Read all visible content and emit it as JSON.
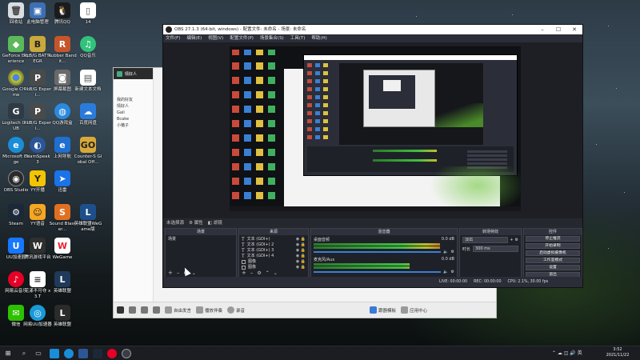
{
  "desktop_icons": [
    {
      "id": "recycle",
      "label": "回收站",
      "icon": "recycle-bin-icon",
      "color": "#d9dde2"
    },
    {
      "id": "geforce",
      "label": "GeForce Experience",
      "icon": "geforce-icon",
      "color": "#5bb85b"
    },
    {
      "id": "chrome",
      "label": "Google Chrome",
      "icon": "chrome-icon",
      "color": "#e53935"
    },
    {
      "id": "logitech",
      "label": "Logitech G HUB",
      "icon": "logitech-icon",
      "color": "#2f3a44"
    },
    {
      "id": "edge",
      "label": "Microsoft Edge",
      "icon": "edge-icon",
      "color": "#1a8dd8"
    },
    {
      "id": "obs",
      "label": "OBS Studio",
      "icon": "obs-icon",
      "color": "#2a2a2a"
    },
    {
      "id": "steam",
      "label": "Steam",
      "icon": "steam-icon",
      "color": "#1b2838"
    },
    {
      "id": "uu",
      "label": "UU加速器",
      "icon": "uu-icon",
      "color": "#1677ff"
    },
    {
      "id": "netease",
      "label": "网易云音乐",
      "icon": "netease-icon",
      "color": "#e60026"
    },
    {
      "id": "wechat",
      "label": "微信",
      "icon": "wechat-icon",
      "color": "#2dc100"
    },
    {
      "id": "computer",
      "label": "此电脑管理",
      "icon": "computer-icon",
      "color": "#3c6fb5"
    },
    {
      "id": "battlerite",
      "label": "RLB/G BATTLEGR",
      "icon": "battleground-icon",
      "color": "#c9a93a"
    },
    {
      "id": "rlbexp1",
      "label": "RLB/G Experi...",
      "icon": "pubg-icon",
      "color": "#4a4a4a"
    },
    {
      "id": "rlbexp2",
      "label": "RLB/G Experi...",
      "icon": "pubg-icon",
      "color": "#4a4a4a"
    },
    {
      "id": "teamspeak",
      "label": "TeamSpeak 3",
      "icon": "teamspeak-icon",
      "color": "#2b5797"
    },
    {
      "id": "yy",
      "label": "YY开播",
      "icon": "yy-icon",
      "color": "#f3c400"
    },
    {
      "id": "yylang",
      "label": "YY语音",
      "icon": "yy-voice-icon",
      "color": "#f5a623"
    },
    {
      "id": "wegame1",
      "label": "腾讯游戏平台",
      "icon": "wegame-icon",
      "color": "#2f2f2f"
    },
    {
      "id": "transmit",
      "label": "花漾不可夺 x3.T",
      "icon": "doc-icon",
      "color": "#ffffff"
    },
    {
      "id": "uninstall",
      "label": "网易UU加速器",
      "icon": "uu-accel-icon",
      "color": "#1a9ad6"
    },
    {
      "id": "qq",
      "label": "腾讯QQ",
      "icon": "qq-icon",
      "color": "#1b1b1b"
    },
    {
      "id": "rubber",
      "label": "Rubber Bandit...",
      "icon": "rubber-icon",
      "color": "#c7552a"
    },
    {
      "id": "shot",
      "label": "屏幕截图",
      "icon": "camera-icon",
      "color": "#6a6a6a"
    },
    {
      "id": "qqgame",
      "label": "QQ游戏盒",
      "icon": "qqgame-icon",
      "color": "#2a8ae0"
    },
    {
      "id": "browser",
      "label": "上网导航",
      "icon": "ie-icon",
      "color": "#1f6fd1"
    },
    {
      "id": "xunlei",
      "label": "迅雷",
      "icon": "xunlei-icon",
      "color": "#1a73e8"
    },
    {
      "id": "sound",
      "label": "Sound Blaster...",
      "icon": "soundblaster-icon",
      "color": "#e07020"
    },
    {
      "id": "wegame2",
      "label": "WeGame",
      "icon": "wegame-icon",
      "color": "#ffffff"
    },
    {
      "id": "thunder",
      "label": "英雄联盟",
      "icon": "lol-icon",
      "color": "#1f3a5a"
    },
    {
      "id": "file14",
      "label": "14",
      "icon": "file-icon",
      "color": "#ffffff"
    },
    {
      "id": "qqmusic",
      "label": "QQ音乐",
      "icon": "qqmusic-icon",
      "color": "#31c27c"
    },
    {
      "id": "newtxt",
      "label": "新建文本文档",
      "icon": "text-file-icon",
      "color": "#ffffff"
    },
    {
      "id": "baidu",
      "label": "百度网盘",
      "icon": "baidu-icon",
      "color": "#2a7bdc"
    },
    {
      "id": "csgo",
      "label": "Counter-S Global Off...",
      "icon": "csgo-icon",
      "color": "#d8a93a"
    },
    {
      "id": "wegame3",
      "label": "英雄联盟WeGame版",
      "icon": "lol-wegame-icon",
      "color": "#1d4f8a"
    },
    {
      "id": "leagues",
      "label": "英雄联盟",
      "icon": "lol-icon",
      "color": "#2b2b2b"
    }
  ],
  "chat": {
    "title": "情好人",
    "groups_label": "我的好友",
    "group_friends": "情好人",
    "items": [
      "Gali",
      "Bcake",
      "小猪子"
    ],
    "bottom_buttons": [
      "自由发言",
      "播放伴奏",
      "录音"
    ],
    "bottom_right": [
      "跟器模板",
      "应用中心"
    ]
  },
  "obs": {
    "title": "OBS 27.1.3 (64-bit, windows) - 配置文件: 未命名 - 场景: 未命名",
    "menu": [
      "文件(F)",
      "编辑(E)",
      "视图(V)",
      "配置文件(P)",
      "场景集合(S)",
      "工具(T)",
      "帮助(H)"
    ],
    "tabs": [
      "未选择源",
      "属性",
      "滤镜"
    ],
    "docks": {
      "scenes": {
        "title": "场景",
        "items": [
          "场景"
        ]
      },
      "sources": {
        "title": "来源",
        "items": [
          "文本 (GDI+)",
          "文本 (GDI+) 2",
          "文本 (GDI+) 3",
          "文本 (GDI+) 4",
          "图像",
          "图像"
        ]
      },
      "mixer": {
        "title": "混音器",
        "channels": [
          {
            "name": "桌面音频",
            "db": "0.0 dB",
            "level": 0.9
          },
          {
            "name": "麦克风/Aux",
            "db": "0.0 dB",
            "level": 0.68
          }
        ]
      },
      "transitions": {
        "title": "转场特效",
        "type": "淡出",
        "duration_label": "时长",
        "duration": "300 ms"
      },
      "controls": {
        "title": "控件",
        "buttons": [
          "停止推流",
          "开始录制",
          "启动虚拟摄像机",
          "工作室模式",
          "设置",
          "退出"
        ]
      }
    },
    "status": {
      "live": "LIVE: 00:00:00",
      "rec": "REC: 00:00:00",
      "cpu": "CPU: 2.1%, 30.00 fps"
    }
  },
  "taskbar": {
    "time": "3:52",
    "date": "2021/11/22",
    "apps": [
      "windows-icon",
      "search-icon",
      "task-view-icon",
      "weixin-icon",
      "edge-icon",
      "chat-icon",
      "steam-icon",
      "netease-icon",
      "obs-icon"
    ]
  }
}
